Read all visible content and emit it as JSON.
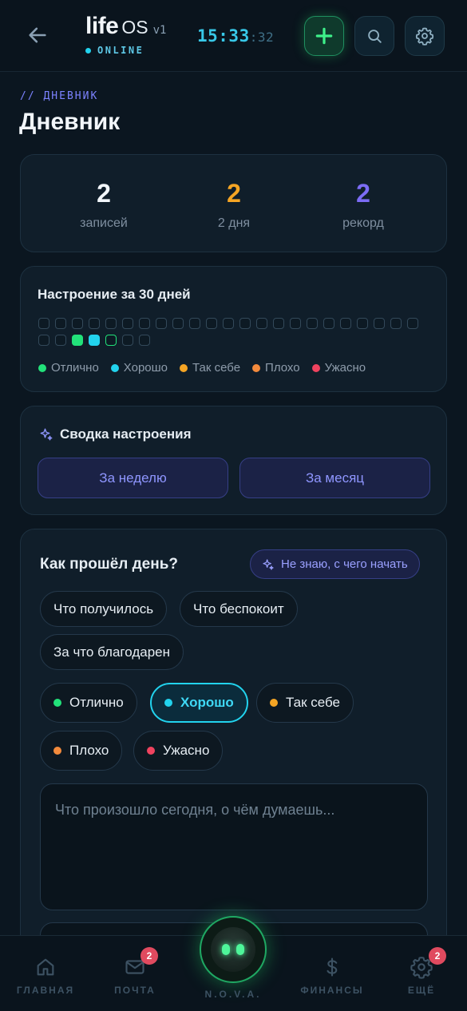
{
  "header": {
    "brand_life": "life",
    "brand_os": "OS",
    "brand_version": "v1",
    "status": "ONLINE",
    "clock_hm": "15:33",
    "clock_sec": ":32"
  },
  "page": {
    "breadcrumb": "// ДНЕВНИК",
    "title": "Дневник"
  },
  "stats": [
    {
      "value": "2",
      "label": "записей",
      "color": "#f2f6fa"
    },
    {
      "value": "2",
      "label": "2 дня",
      "color": "#f5a524"
    },
    {
      "value": "2",
      "label": "рекорд",
      "color": "#7c6cf5"
    }
  ],
  "mood30": {
    "title": "Настроение за 30 дней",
    "days_filled": {
      "25": "excellent",
      "26": "good",
      "27": "today-outline"
    },
    "legend": [
      {
        "label": "Отлично",
        "color": "#22e27a"
      },
      {
        "label": "Хорошо",
        "color": "#22d3ee"
      },
      {
        "label": "Так себе",
        "color": "#f5a524"
      },
      {
        "label": "Плохо",
        "color": "#f38a3c"
      },
      {
        "label": "Ужасно",
        "color": "#f0435f"
      }
    ]
  },
  "summary": {
    "title": "Сводка настроения",
    "week_label": "За неделю",
    "month_label": "За месяц"
  },
  "day": {
    "title": "Как прошёл день?",
    "hint_label": "Не знаю, с чего начать",
    "prompts": [
      "Что получилось",
      "Что беспокоит",
      "За что благодарен"
    ],
    "moods": [
      {
        "label": "Отлично",
        "color": "#22e27a",
        "selected": false
      },
      {
        "label": "Хорошо",
        "color": "#22d3ee",
        "selected": true
      },
      {
        "label": "Так себе",
        "color": "#f5a524",
        "selected": false
      },
      {
        "label": "Плохо",
        "color": "#f38a3c",
        "selected": false
      },
      {
        "label": "Ужасно",
        "color": "#f0435f",
        "selected": false
      }
    ],
    "placeholder": "Что произошло сегодня, о чём думаешь..."
  },
  "nav": {
    "home": "ГЛАВНАЯ",
    "mail": "ПОЧТА",
    "mail_badge": "2",
    "nova": "N.O.V.A.",
    "finance": "ФИНАНСЫ",
    "more": "ЕЩЁ",
    "more_badge": "2"
  }
}
